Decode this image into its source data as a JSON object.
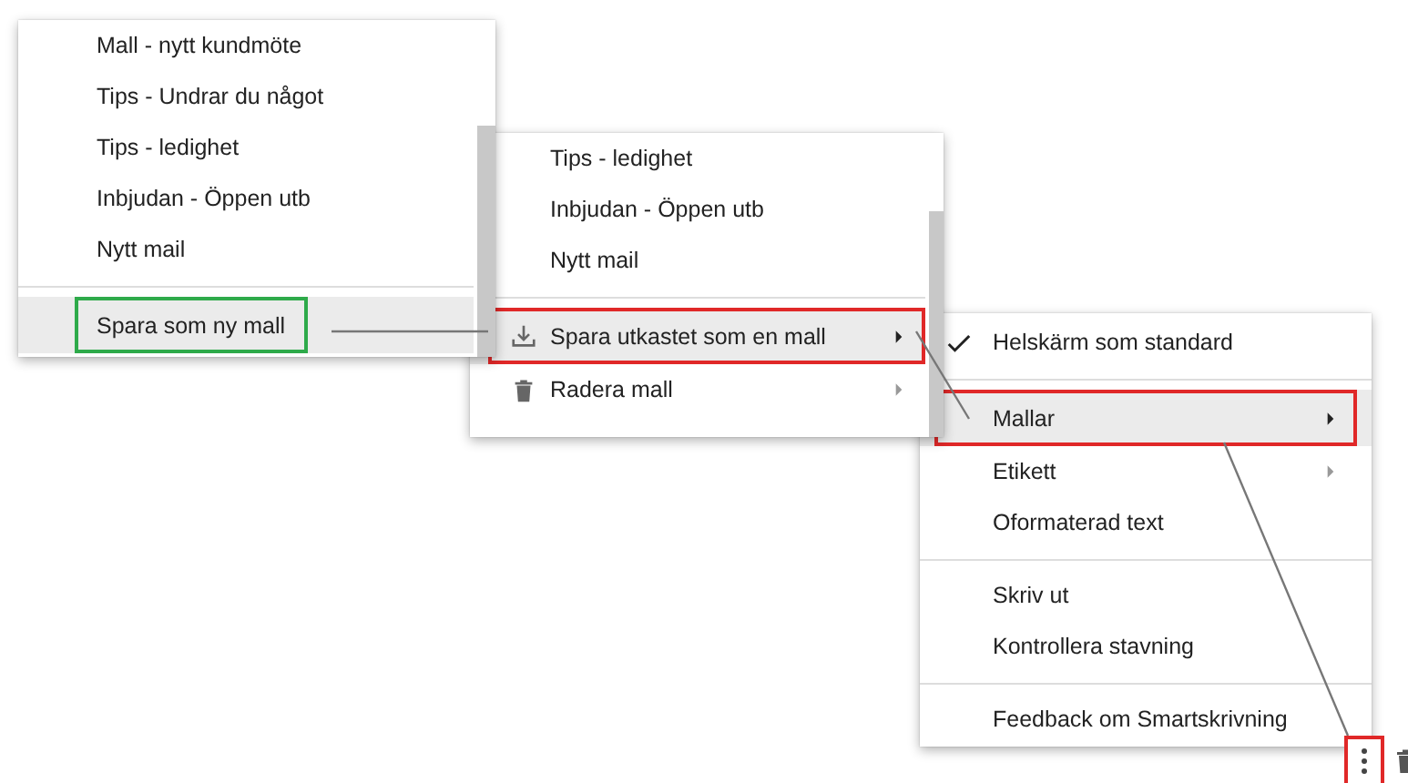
{
  "menus": [
    {
      "items": [
        {
          "kind": "item",
          "label": "Mall - nytt kundmöte",
          "selected": false
        },
        {
          "kind": "item",
          "label": "Tips - Undrar du något",
          "selected": false
        },
        {
          "kind": "item",
          "label": "Tips - ledighet",
          "selected": false
        },
        {
          "kind": "item",
          "label": "Inbjudan - Öppen utb",
          "selected": false
        },
        {
          "kind": "item",
          "label": "Nytt mail",
          "selected": false
        },
        {
          "kind": "divider"
        },
        {
          "kind": "item",
          "label": "Spara som ny mall",
          "selected": true,
          "color": "#2eaa4a"
        }
      ]
    },
    {
      "items": [
        {
          "kind": "item",
          "label": "Tips - ledighet",
          "selected": false
        },
        {
          "kind": "item",
          "label": "Inbjudan - Öppen utb",
          "selected": false
        },
        {
          "kind": "item",
          "label": "Nytt mail",
          "selected": false
        },
        {
          "kind": "divider"
        },
        {
          "kind": "download",
          "label": "Spara utkastet som en mall",
          "selected": true,
          "submenu": true,
          "color": "#e02828"
        },
        {
          "kind": "trash",
          "label": "Radera mall",
          "selected": false,
          "submenu": true
        }
      ]
    },
    {
      "items": [
        {
          "kind": "item",
          "label": "Helskärm som standard",
          "selected": false,
          "checked": true
        },
        {
          "kind": "divider"
        },
        {
          "kind": "item",
          "label": "Mallar",
          "selected": true,
          "submenu": true,
          "color": "#e02828"
        },
        {
          "kind": "item",
          "label": "Etikett",
          "selected": false,
          "submenu": true
        },
        {
          "kind": "item",
          "label": "Oformaterad text",
          "selected": false
        },
        {
          "kind": "divider"
        },
        {
          "kind": "item",
          "label": "Skriv ut",
          "selected": false
        },
        {
          "kind": "item",
          "label": "Kontrollera stavning",
          "selected": false
        },
        {
          "kind": "divider"
        },
        {
          "kind": "item",
          "label": "Feedback om Smartskrivning",
          "selected": false
        }
      ]
    }
  ],
  "toolbar": [
    {
      "kind": "more",
      "color": "#e02828"
    },
    {
      "kind": "trash"
    }
  ]
}
